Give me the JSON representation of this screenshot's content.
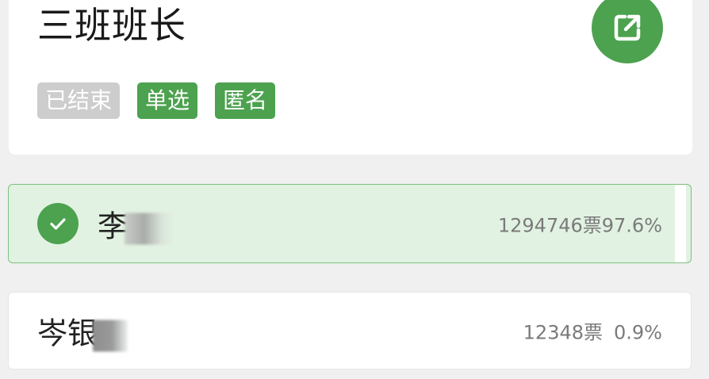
{
  "poll": {
    "title": "三班班长",
    "tags": {
      "status": "已结束",
      "mode": "单选",
      "anonymity": "匿名"
    }
  },
  "options": [
    {
      "name": "李",
      "votes": "1294746票",
      "percent": "97.6%",
      "selected": true
    },
    {
      "name": "岑银",
      "votes": "12348票",
      "percent": "0.9%",
      "selected": false
    }
  ],
  "icons": {
    "share": "share-external-icon",
    "check": "check-circle-icon"
  },
  "colors": {
    "accent": "#4ca24e",
    "selected_bg": "#e2f2e2",
    "tag_ended": "#cdcdcd"
  }
}
